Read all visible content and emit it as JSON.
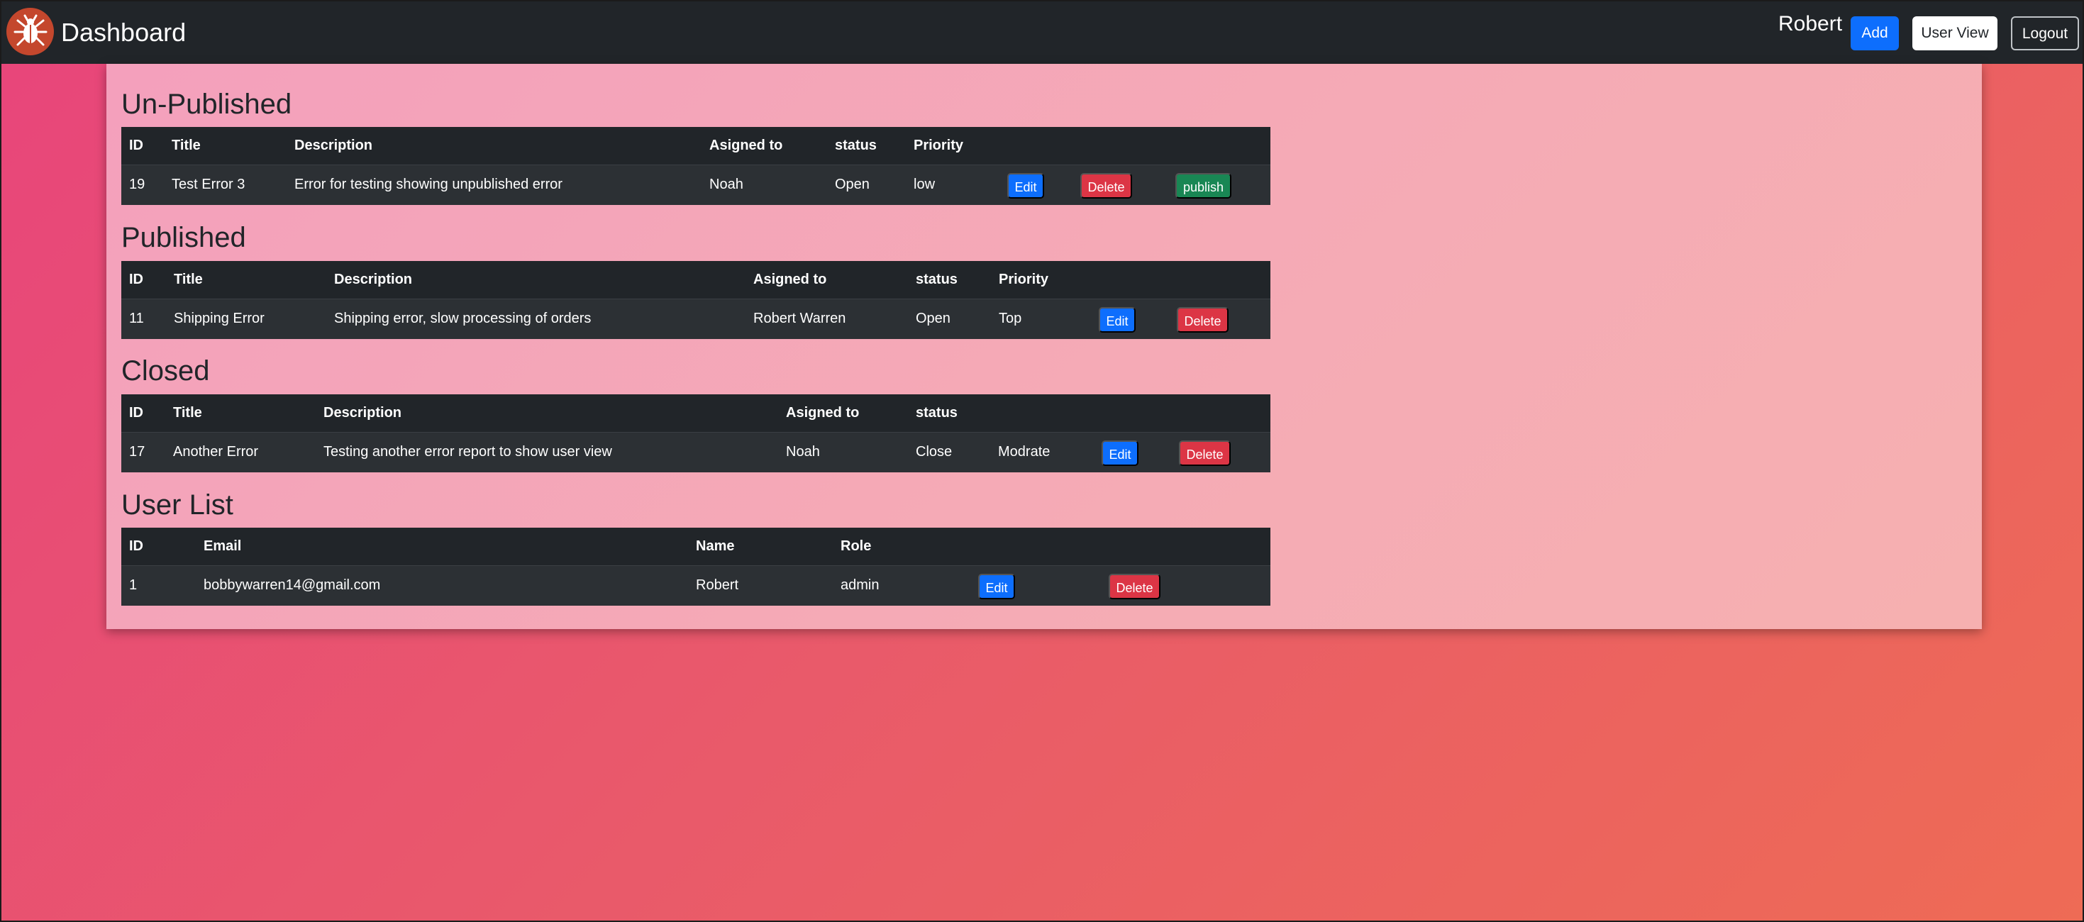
{
  "navbar": {
    "brand": "Dashboard",
    "logo_icon": "bug-logo-icon",
    "user_name": "Robert",
    "add_label": "Add",
    "user_view_label": "User View",
    "logout_label": "Logout"
  },
  "colors": {
    "primary": "#0d6efd",
    "danger": "#dc3545",
    "success": "#198754",
    "dark": "#212529"
  },
  "unpublished": {
    "title": "Un-Published",
    "headers": [
      "ID",
      "Title",
      "Description",
      "Asigned to",
      "status",
      "Priority"
    ],
    "rows": [
      {
        "id": "19",
        "title": "Test Error 3",
        "description": "Error for testing showing unpublished error",
        "assigned": "Noah",
        "status": "Open",
        "priority": "low",
        "edit": "Edit",
        "delete": "Delete",
        "publish": "publish"
      }
    ]
  },
  "published": {
    "title": "Published",
    "headers": [
      "ID",
      "Title",
      "Description",
      "Asigned to",
      "status",
      "Priority"
    ],
    "rows": [
      {
        "id": "11",
        "title": "Shipping Error",
        "description": "Shipping error, slow processing of orders",
        "assigned": "Robert Warren",
        "status": "Open",
        "priority": "Top",
        "edit": "Edit",
        "delete": "Delete"
      }
    ]
  },
  "closed": {
    "title": "Closed",
    "headers": [
      "ID",
      "Title",
      "Description",
      "Asigned to",
      "status"
    ],
    "rows": [
      {
        "id": "17",
        "title": "Another Error",
        "description": "Testing another error report to show user view",
        "assigned": "Noah",
        "status": "Close",
        "priority": "Modrate",
        "edit": "Edit",
        "delete": "Delete"
      }
    ]
  },
  "users": {
    "title": "User List",
    "headers": [
      "ID",
      "Email",
      "Name",
      "Role"
    ],
    "rows": [
      {
        "id": "1",
        "email": "bobbywarren14@gmail.com",
        "name": "Robert",
        "role": "admin",
        "edit": "Edit",
        "delete": "Delete"
      }
    ]
  }
}
